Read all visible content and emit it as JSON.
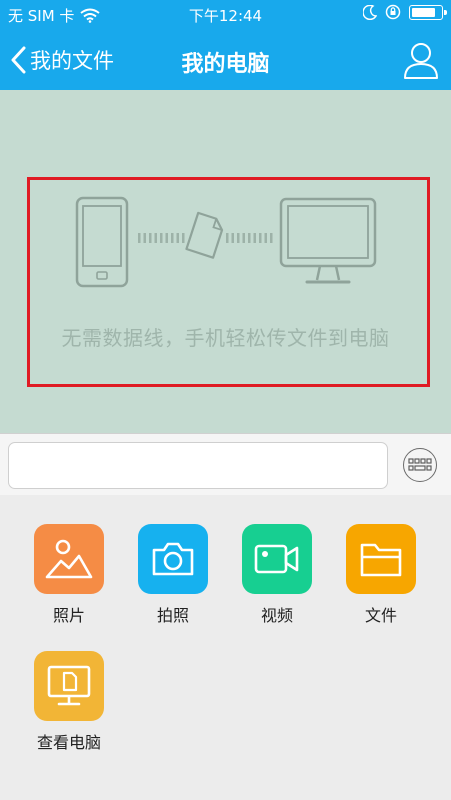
{
  "status_bar": {
    "carrier": "无 SIM 卡",
    "time": "下午12:44",
    "battery_level": 0.85
  },
  "nav": {
    "back_label": "我的文件",
    "title": "我的电脑"
  },
  "hero": {
    "caption": "无需数据线，手机轻松传文件到电脑"
  },
  "input": {
    "value": "",
    "placeholder": ""
  },
  "actions": [
    {
      "label": "照片",
      "icon": "photo-icon",
      "color": "#f58c45"
    },
    {
      "label": "拍照",
      "icon": "camera-icon",
      "color": "#16b1ef"
    },
    {
      "label": "视频",
      "icon": "video-icon",
      "color": "#17cf91"
    },
    {
      "label": "文件",
      "icon": "folder-icon",
      "color": "#f7a600"
    },
    {
      "label": "查看电脑",
      "icon": "computer-file-icon",
      "color": "#f2b536"
    }
  ],
  "colors": {
    "nav_bar": "#18a9ec",
    "hero_bg": "#c5dbd1",
    "highlight_border": "#e01b24"
  }
}
